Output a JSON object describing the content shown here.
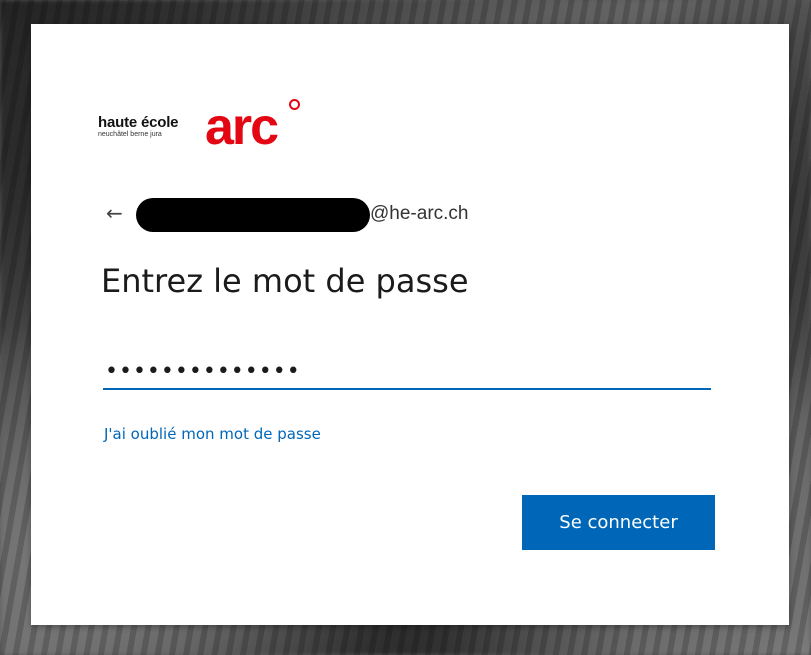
{
  "logo": {
    "line1": "haute école",
    "line2": "neuchâtel berne jura",
    "brand": "arc",
    "brand_color": "#e30613"
  },
  "identity": {
    "back_icon": "arrow-left-icon",
    "email_domain": "@he-arc.ch"
  },
  "title": "Entrez le mot de passe",
  "password": {
    "value": "••••••••••••••",
    "underline_color": "#0067b8"
  },
  "forgot_link": "J'ai oublié mon mot de passe",
  "signin_button": "Se connecter",
  "accent_color": "#0067b8"
}
